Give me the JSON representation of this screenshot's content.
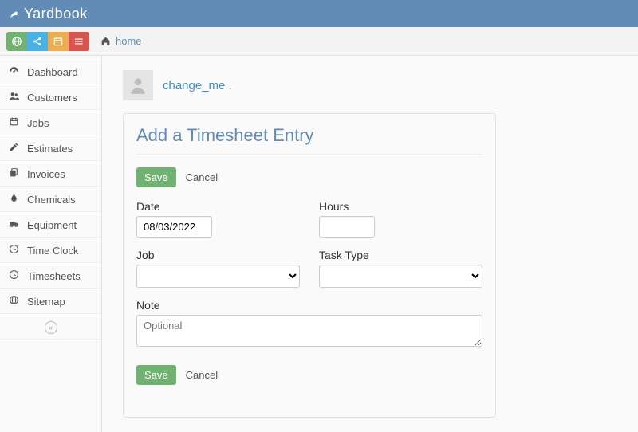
{
  "brand": "Yardbook",
  "breadcrumb": "home",
  "sidebar": {
    "items": [
      {
        "label": "Dashboard",
        "icon": "tach"
      },
      {
        "label": "Customers",
        "icon": "users"
      },
      {
        "label": "Jobs",
        "icon": "cal"
      },
      {
        "label": "Estimates",
        "icon": "pencil"
      },
      {
        "label": "Invoices",
        "icon": "copy"
      },
      {
        "label": "Chemicals",
        "icon": "drop"
      },
      {
        "label": "Equipment",
        "icon": "truck"
      },
      {
        "label": "Time Clock",
        "icon": "clock"
      },
      {
        "label": "Timesheets",
        "icon": "clock"
      },
      {
        "label": "Sitemap",
        "icon": "globe"
      }
    ]
  },
  "user_link": "change_me .",
  "form": {
    "title": "Add a Timesheet Entry",
    "save": "Save",
    "cancel": "Cancel",
    "labels": {
      "date": "Date",
      "hours": "Hours",
      "job": "Job",
      "task": "Task Type",
      "note": "Note"
    },
    "values": {
      "date": "08/03/2022",
      "hours": "",
      "job": "",
      "task": "",
      "note": ""
    },
    "placeholders": {
      "note": "Optional"
    }
  }
}
